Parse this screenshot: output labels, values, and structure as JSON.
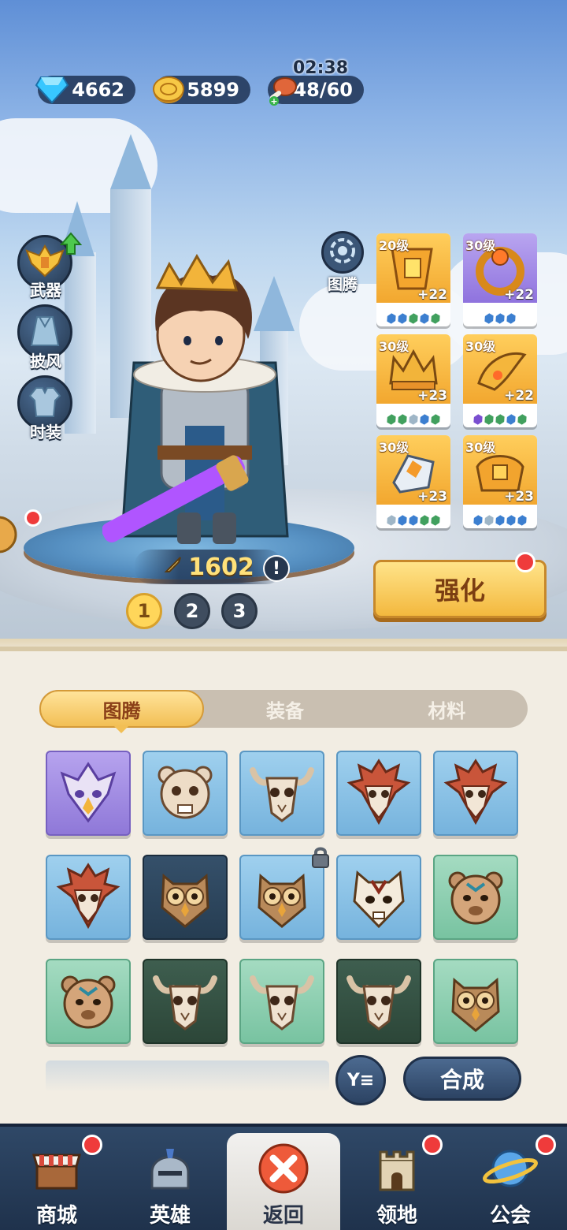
{
  "resources": {
    "gems": "4662",
    "gold": "5899",
    "stamina": "48/60",
    "stamina_timer": "02:38"
  },
  "side_buttons": {
    "weapon": "武器",
    "cloak": "披风",
    "costume": "时装"
  },
  "hero": {
    "power": "1602",
    "info": "!"
  },
  "pages": [
    "1",
    "2",
    "3"
  ],
  "totem": {
    "label": "图腾"
  },
  "equipment": [
    {
      "level": "20级",
      "plus": "+22",
      "rarity": "orange",
      "gems": [
        "#3c7fd0",
        "#3c7fd0",
        "#41a05e",
        "#3c7fd0",
        "#41a05e"
      ]
    },
    {
      "level": "30级",
      "plus": "+22",
      "rarity": "purple",
      "gems": [
        "#3c7fd0",
        "#3c7fd0",
        "#3c7fd0"
      ]
    },
    {
      "level": "30级",
      "plus": "+23",
      "rarity": "orange",
      "gems": [
        "#41a05e",
        "#41a05e",
        "#9fb6c7",
        "#3c7fd0",
        "#41a05e"
      ]
    },
    {
      "level": "30级",
      "plus": "+22",
      "rarity": "orange",
      "gems": [
        "#7a4fd0",
        "#41a05e",
        "#41a05e",
        "#3c7fd0",
        "#41a05e"
      ]
    },
    {
      "level": "30级",
      "plus": "+23",
      "rarity": "orange",
      "gems": [
        "#9fb6c7",
        "#3c7fd0",
        "#3c7fd0",
        "#41a05e",
        "#41a05e"
      ]
    },
    {
      "level": "30级",
      "plus": "+23",
      "rarity": "orange",
      "gems": [
        "#3c7fd0",
        "#9fb6c7",
        "#3c7fd0",
        "#3c7fd0",
        "#3c7fd0"
      ]
    }
  ],
  "upgrade_button": "强化",
  "tabs": [
    "图腾",
    "装备",
    "材料"
  ],
  "grid": [
    {
      "color": "purple",
      "icon": "eagle-mask-icon"
    },
    {
      "color": "blue",
      "icon": "bear-skull-icon"
    },
    {
      "color": "blue",
      "icon": "bull-skull-icon"
    },
    {
      "color": "blue",
      "icon": "eagle-skull-icon"
    },
    {
      "color": "blue",
      "icon": "eagle-skull-icon"
    },
    {
      "color": "blue",
      "icon": "eagle-skull-icon"
    },
    {
      "color": "darkblue",
      "icon": "owl-mask-icon"
    },
    {
      "color": "blue",
      "icon": "owl-mask-icon",
      "locked": true
    },
    {
      "color": "blue",
      "icon": "tiger-skull-icon"
    },
    {
      "color": "green",
      "icon": "bear-mask-icon"
    },
    {
      "color": "green",
      "icon": "bear-mask-icon"
    },
    {
      "color": "darkgreen",
      "icon": "bull-skull-icon"
    },
    {
      "color": "green",
      "icon": "bull-skull-icon"
    },
    {
      "color": "darkgreen",
      "icon": "bull-skull-icon"
    },
    {
      "color": "green",
      "icon": "owl-mask-icon"
    }
  ],
  "filter_button": "Y≡",
  "merge_button": "合成",
  "nav": [
    {
      "label": "商城",
      "icon": "shop-icon",
      "badge": true
    },
    {
      "label": "英雄",
      "icon": "helmet-icon",
      "badge": false
    },
    {
      "label": "返回",
      "icon": "close-icon",
      "badge": false,
      "active": true
    },
    {
      "label": "领地",
      "icon": "castle-icon",
      "badge": true
    },
    {
      "label": "公会",
      "icon": "planet-icon",
      "badge": true
    }
  ]
}
